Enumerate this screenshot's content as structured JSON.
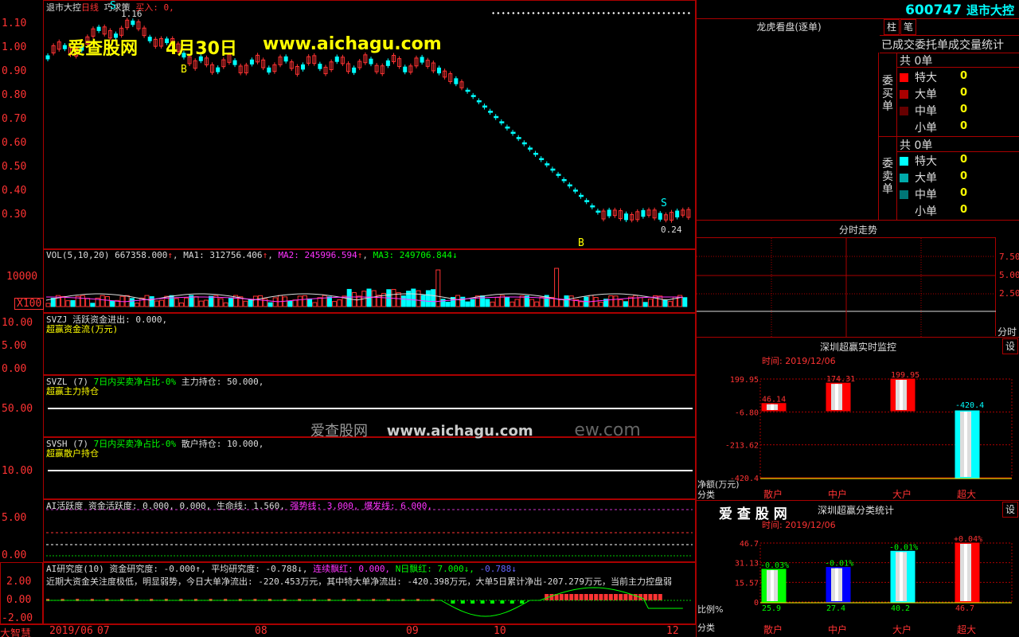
{
  "header": {
    "stock_name": "退市大控",
    "period": "日线",
    "strategy": "巧求策",
    "buy_label": "买入: 0,",
    "code": "600747",
    "code_name": "退市大控"
  },
  "watermark": {
    "brand": "爱查股网",
    "date": "4月30日",
    "url": "www.aichagu.com",
    "center_brand": "爱查股网",
    "center_url": "www.aichagu.com",
    "ghost_suffix": "ew.com"
  },
  "price_panel": {
    "y_ticks": [
      "1.10",
      "1.00",
      "0.90",
      "0.80",
      "0.70",
      "0.60",
      "0.50",
      "0.40",
      "0.30"
    ],
    "high_label": "1.16",
    "low_label": "0.24",
    "marker_b1": "B",
    "marker_s1": "S",
    "marker_b2": "B",
    "marker_s2": "S",
    "marker_s_top": "S"
  },
  "vol_panel": {
    "label": "VOL(5,10,20)",
    "value": "667358.000",
    "ma1": "MA1: 312756.406",
    "ma2": "MA2: 245996.594",
    "ma3": "MA3: 249706.844",
    "y_tick": "10000",
    "unit": "X100"
  },
  "svzj_panel": {
    "title": "SVZJ",
    "desc": "活跃资金进出: 0.000,",
    "sub": "超赢资金流(万元)",
    "y_ticks": [
      "10.00",
      "5.00",
      "0.00"
    ]
  },
  "svzl_panel": {
    "title": "SVZL (7)",
    "desc_green": "7日内买卖净占比-0%",
    "desc_white": "主力持仓: 50.000,",
    "sub": "超赢主力持仓",
    "y_tick": "50.00"
  },
  "svsh_panel": {
    "title": "SVSH (7)",
    "desc_green": "7日内买卖净占比-0%",
    "desc_white": "散户持仓: 10.000,",
    "sub": "超赢散户持仓",
    "y_tick": "10.00"
  },
  "ai_active": {
    "title": "AI活跃度",
    "desc": "资金活跃度: 0.000, 0.000, 生命线: 1.560,",
    "strong": "强势线: 3.000,",
    "burst": "爆发线: 6.000,",
    "y_ticks": [
      "5.00",
      "0.00"
    ]
  },
  "ai_research": {
    "title": "AI研究度(10)",
    "desc": "资金研究度: -0.000↑, 平均研究度: -0.788↓,",
    "red1": "连续飘红: 0.000,",
    "green1": "N日飘红: 7.000↓,",
    "blue1": "-0.788↓",
    "comment": "近期大资金关注度极低，明显弱势，今日大单净流出: -220.453万元，其中特大单净流出: -420.398万元，大单5日累计净出-207.279万元，当前主力控盘弱",
    "y_ticks": [
      "2.00",
      "0.00",
      "-2.00"
    ]
  },
  "time_axis": {
    "labels": [
      "2019/06",
      "07",
      "08",
      "09",
      "10",
      "12"
    ],
    "app_name": "大智慧"
  },
  "right_panel": {
    "dragon_title": "龙虎看盘(逐单)",
    "stats_title": "已成交委托单成交量统计",
    "buy_group": "委买单",
    "sell_group": "委卖单",
    "buy_total": "共 0单",
    "sell_total": "共 0单",
    "buy_rows": [
      {
        "label": "特大",
        "value": "0",
        "color": "#ff0000"
      },
      {
        "label": "大单",
        "value": "0",
        "color": "#aa0000"
      },
      {
        "label": "中单",
        "value": "0",
        "color": "#660000"
      },
      {
        "label": "小单",
        "value": "0",
        "color": "#000000"
      }
    ],
    "sell_rows": [
      {
        "label": "特大",
        "value": "0",
        "color": "#00ffff"
      },
      {
        "label": "大单",
        "value": "0",
        "color": "#00aaaa"
      },
      {
        "label": "中单",
        "value": "0",
        "color": "#007777"
      },
      {
        "label": "小单",
        "value": "0",
        "color": "#000000"
      }
    ],
    "btn_column": "柱",
    "btn_pen": "笔",
    "intraday_title": "分时走势",
    "intraday_ticks": [
      "7.50",
      "5.00",
      "2.50"
    ],
    "intraday_label": "分时",
    "monitor_title": "深圳超赢实时监控",
    "settings": "设",
    "time1": "时间: 2019/12/06",
    "monitor_y": [
      "199.95",
      "-6.80",
      "-213.62",
      "-420.4"
    ],
    "monitor_unit": "净额(万元)",
    "monitor_cat_label": "分类",
    "class_brand": "爱 查 股 网",
    "class_title": "深圳超赢分类统计",
    "time2": "时间: 2019/12/06",
    "class_y": [
      "46.7",
      "31.13",
      "15.57",
      "0"
    ],
    "ratio_label": "比例%",
    "class_cat_label": "分类"
  },
  "chart_data": [
    {
      "type": "bar",
      "title": "深圳超赢实时监控",
      "categories": [
        "散户",
        "中户",
        "大户",
        "超大"
      ],
      "values": [
        46.14,
        174.31,
        199.95,
        -420.4
      ],
      "ylabel": "净额(万元)",
      "ylim": [
        -420.4,
        199.95
      ],
      "colors": [
        "#ff0000",
        "#ff0000",
        "#ff0000",
        "#00ffff"
      ]
    },
    {
      "type": "bar",
      "title": "深圳超赢分类统计",
      "categories": [
        "散户",
        "中户",
        "大户",
        "超大"
      ],
      "values": [
        25.9,
        27.4,
        40.2,
        46.7
      ],
      "top_labels": [
        "-0.03%",
        "-0.01%",
        "-0.01%",
        "+0.04%"
      ],
      "ylabel": "比例%",
      "ylim": [
        0,
        46.7
      ],
      "colors": [
        "#00ff00",
        "#0000ff",
        "#00ffff",
        "#ff0000"
      ]
    }
  ]
}
